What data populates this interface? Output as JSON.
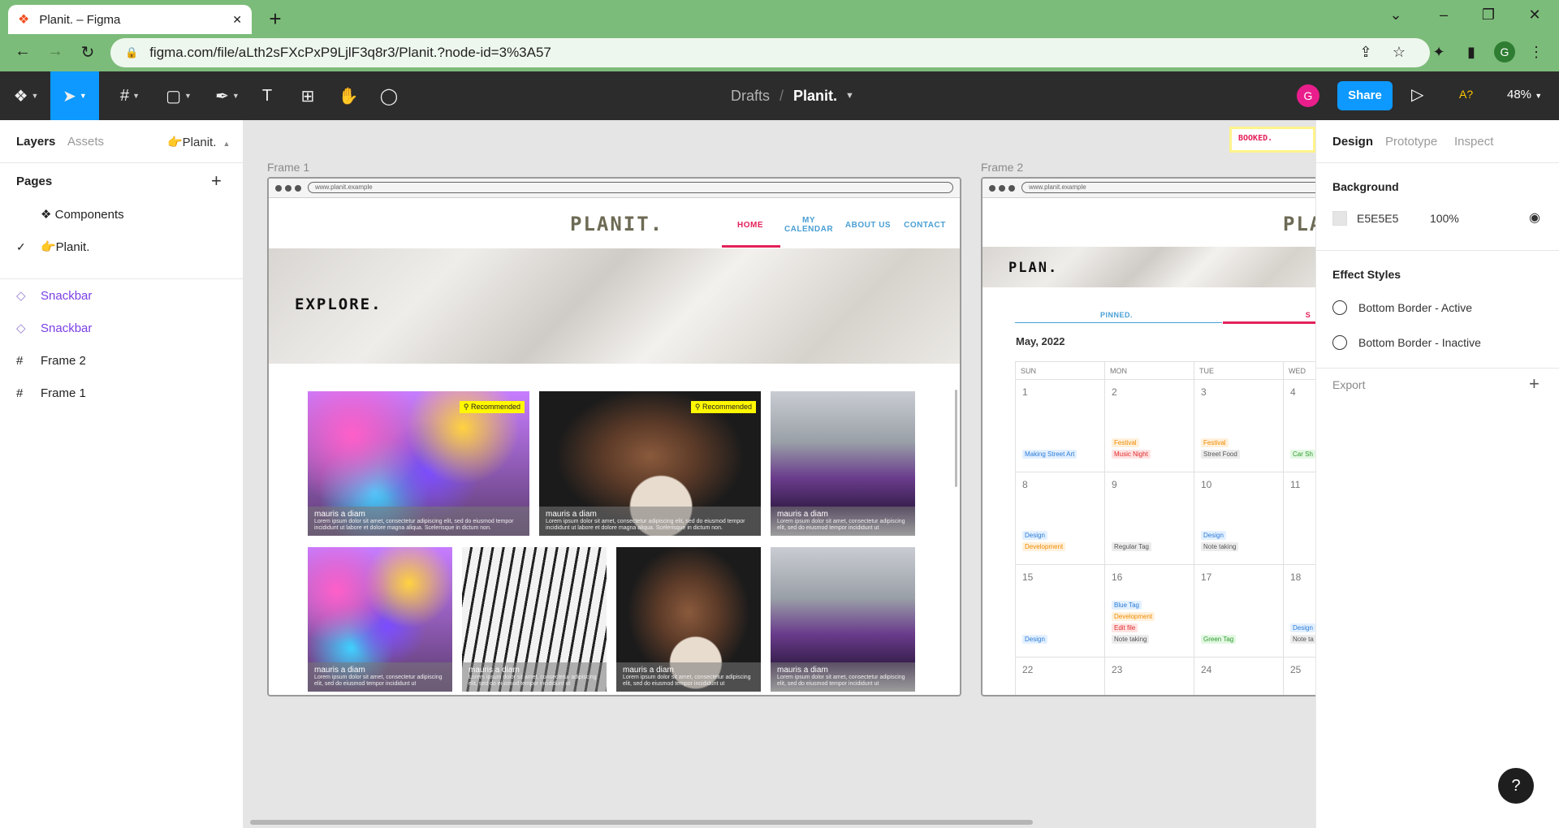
{
  "browser": {
    "tab_title": "Planit. – Figma",
    "url": "figma.com/file/aLth2sFXcPxP9LjlF3q8r3/Planit.?node-id=3%3A57",
    "profile_initial": "G"
  },
  "figma_toolbar": {
    "breadcrumb_drafts": "Drafts",
    "breadcrumb_sep": "/",
    "file_name": "Planit.",
    "avatar_initial": "G",
    "share_label": "Share",
    "a11y_label": "A?",
    "zoom": "48%"
  },
  "left_panel": {
    "tab_layers": "Layers",
    "tab_assets": "Assets",
    "page_switcher": "👉Planit.",
    "pages_title": "Pages",
    "pages": [
      {
        "label": "❖ Components",
        "selected": false
      },
      {
        "label": "👉Planit.",
        "selected": true
      }
    ],
    "layers": [
      {
        "label": "Snackbar",
        "type": "component"
      },
      {
        "label": "Snackbar",
        "type": "component"
      },
      {
        "label": "Frame 2",
        "type": "frame"
      },
      {
        "label": "Frame 1",
        "type": "frame"
      }
    ]
  },
  "canvas": {
    "frame1": {
      "label": "Frame 1",
      "url": "www.planit.example",
      "logo": "PLANIT.",
      "nav": [
        {
          "label": "HOME",
          "active": true
        },
        {
          "label": "MY CALENDAR",
          "active": false
        },
        {
          "label": "ABOUT US",
          "active": false
        },
        {
          "label": "CONTACT",
          "active": false
        }
      ],
      "hero_title": "EXPLORE.",
      "cards": [
        {
          "title": "mauris a diam",
          "desc": "Lorem ipsum dolor sit amet, consectetur adipiscing elit, sed do eiusmod tempor incididunt ut labore et dolore magna aliqua. Scelerisque in dictum non.",
          "badge": "Recommended",
          "image": "holi"
        },
        {
          "title": "mauris a diam",
          "desc": "Lorem ipsum dolor sit amet, consectetur adipiscing elit, sed do eiusmod tempor incididunt ut labore et dolore magna aliqua. Scelerisque in dictum non.",
          "badge": "Recommended",
          "image": "pottery"
        },
        {
          "title": "mauris a diam",
          "desc": "Lorem ipsum dolor sit amet, consectetur adipiscing elit, sed do eiusmod tempor incididunt ut",
          "badge": "",
          "image": "cars"
        },
        {
          "title": "mauris a diam",
          "desc": "Lorem ipsum dolor sit amet, consectetur adipiscing elit, sed do eiusmod tempor incididunt ut",
          "badge": "",
          "image": "holi"
        },
        {
          "title": "mauris a diam",
          "desc": "Lorem ipsum dolor sit amet, consectetur adipiscing elit, sed do eiusmod tempor incididunt ut",
          "badge": "",
          "image": "keys"
        },
        {
          "title": "mauris a diam",
          "desc": "Lorem ipsum dolor sit amet, consectetur adipiscing elit, sed do eiusmod tempor incididunt ut",
          "badge": "",
          "image": "pottery"
        },
        {
          "title": "mauris a diam",
          "desc": "Lorem ipsum dolor sit amet, consectetur adipiscing elit, sed do eiusmod tempor incididunt ut",
          "badge": "",
          "image": "cars"
        }
      ]
    },
    "frame2": {
      "label": "Frame 2",
      "url": "www.planit.example",
      "logo": "PLA",
      "hero_title": "PLAN.",
      "tab_pinned": "PINNED.",
      "tab_s": "S",
      "month": "May, 2022",
      "dows": [
        "SUN",
        "MON",
        "TUE",
        "WED"
      ],
      "weeks": [
        {
          "days": [
            "1",
            "2",
            "3",
            "4"
          ]
        },
        {
          "days": [
            "8",
            "9",
            "10",
            "11"
          ]
        },
        {
          "days": [
            "15",
            "16",
            "17",
            "18"
          ]
        },
        {
          "days": [
            "22",
            "23",
            "24",
            "25"
          ]
        }
      ],
      "tags": {
        "w0d0": [
          {
            "text": "Making Street Art",
            "color": "blue"
          }
        ],
        "w0d1": [
          {
            "text": "Festival",
            "color": "orange"
          },
          {
            "text": "Music Night",
            "color": "red"
          }
        ],
        "w0d2": [
          {
            "text": "Festival",
            "color": "orange"
          },
          {
            "text": "Street Food",
            "color": "gray"
          }
        ],
        "w0d3": [
          {
            "text": "Car Sh",
            "color": "green"
          }
        ],
        "w1d0": [
          {
            "text": "Design",
            "color": "blue"
          },
          {
            "text": "Development",
            "color": "orange"
          }
        ],
        "w1d1": [
          {
            "text": "Regular Tag",
            "color": "gray"
          }
        ],
        "w1d2": [
          {
            "text": "Design",
            "color": "blue"
          },
          {
            "text": "Note taking",
            "color": "gray"
          }
        ],
        "w2d0": [
          {
            "text": "Design",
            "color": "blue"
          }
        ],
        "w2d1": [
          {
            "text": "Blue Tag",
            "color": "blue"
          },
          {
            "text": "Development",
            "color": "orange"
          },
          {
            "text": "Edit file",
            "color": "red"
          },
          {
            "text": "Note taking",
            "color": "gray"
          }
        ],
        "w2d2": [
          {
            "text": "Green Tag",
            "color": "green"
          }
        ],
        "w2d3": [
          {
            "text": "Design",
            "color": "blue"
          },
          {
            "text": "Note ta",
            "color": "gray"
          }
        ]
      }
    },
    "booked_chip": "BOOKED."
  },
  "right_panel": {
    "tabs": [
      "Design",
      "Prototype",
      "Inspect"
    ],
    "active_tab": "Design",
    "background_title": "Background",
    "bg_color_hex": "E5E5E5",
    "bg_opacity": "100%",
    "effect_styles_title": "Effect Styles",
    "effects": [
      "Bottom Border - Active",
      "Bottom Border - Inactive"
    ],
    "export_title": "Export"
  },
  "help_label": "?",
  "colors": {
    "browser_green": "#7cbc7a",
    "figma_blue": "#0d99ff",
    "accent_pink": "#e3215a",
    "nav_blue": "#4a9fd4"
  }
}
